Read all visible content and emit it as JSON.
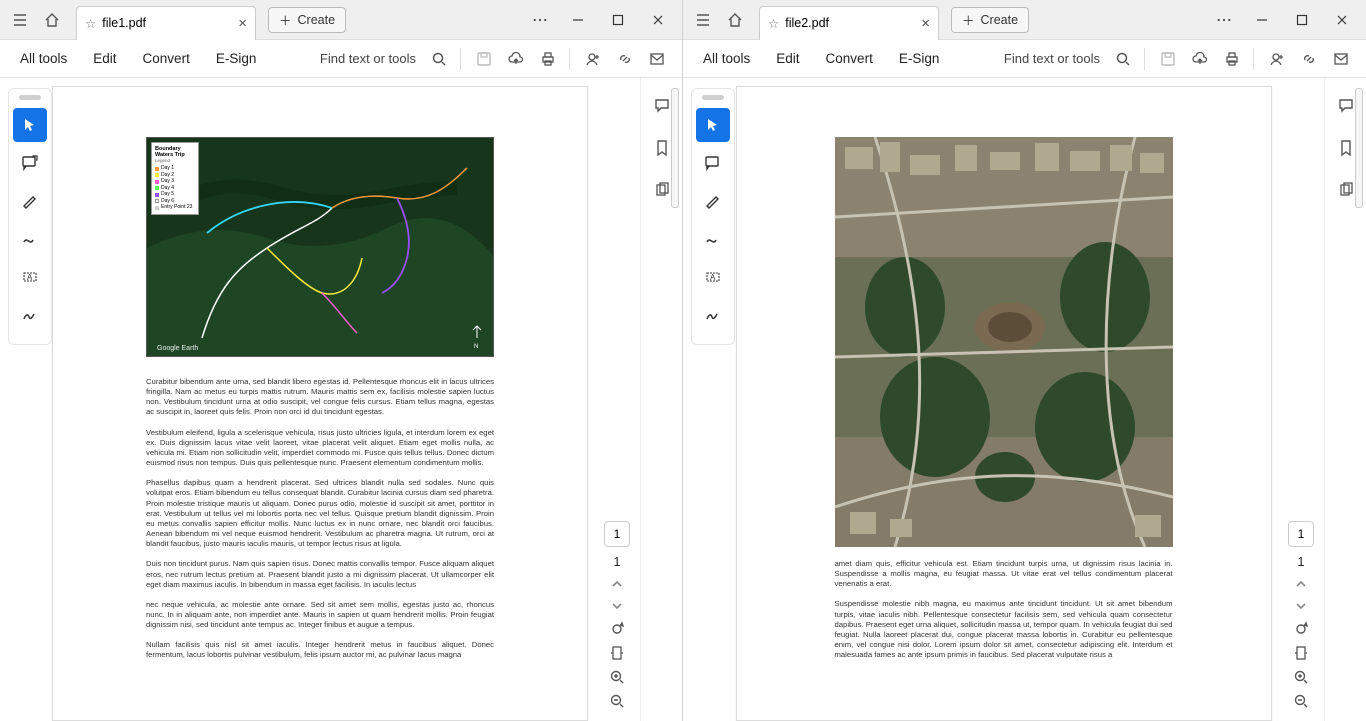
{
  "panes": [
    {
      "tab_title": "file1.pdf",
      "create_label": "Create",
      "menus": {
        "all_tools": "All tools",
        "edit": "Edit",
        "convert": "Convert",
        "esign": "E-Sign"
      },
      "find_label": "Find text or tools",
      "page_current": "1",
      "page_total": "1",
      "map": {
        "title": "Boundary Waters Trip",
        "legend_label": "Legend",
        "items": [
          {
            "label": "Day 1",
            "color": "#ff9a3c"
          },
          {
            "label": "Day 2",
            "color": "#ffeb3b"
          },
          {
            "label": "Day 3",
            "color": "#ff5dd2"
          },
          {
            "label": "Day 4",
            "color": "#55ff55"
          },
          {
            "label": "Day 5",
            "color": "#9a4dff"
          },
          {
            "label": "Day 6",
            "color": "#ffffff"
          },
          {
            "label": "Entry Point 23",
            "color": "#d0d0d0"
          }
        ],
        "watermark": "Google Earth"
      },
      "paragraphs": [
        "Curabitur bibendum ante urna, sed blandit libero egestas id. Pellentesque rhoncus elit in lacus ultrices fringilla. Nam ac metus eu turpis mattis rutrum. Mauris mattis sem ex, facilisis molestie sapien luctus non. Vestibulum tincidunt urna at odio suscipit, vel congue felis cursus. Etiam tellus magna, egestas ac suscipit in, laoreet quis felis. Proin non orci id dui tincidunt egestas.",
        "Vestibulum eleifend, ligula a scelerisque vehicula, risus justo ultricies ligula, et interdum lorem ex eget ex. Duis dignissim lacus vitae velit laoreet, vitae placerat velit aliquet. Etiam eget mollis nulla, ac vehicula mi. Etiam non sollicitudin velit, imperdiet commodo mi. Fusce quis tellus tellus. Donec dictum euismod risus non tempus. Duis quis pellentesque nunc. Praesent elementum condimentum mollis.",
        "Phasellus dapibus quam a hendrerit placerat. Sed ultrices blandit nulla sed sodales. Nunc quis volutpat eros. Etiam bibendum eu tellus consequat blandit. Curabitur lacinia cursus diam sed pharetra. Proin molestie tristique mauris ut aliquam. Donec purus odio, molestie id suscipit sit amet, porttitor in erat. Vestibulum ut tellus vel mi lobortis porta nec vel tellus. Quisque pretium blandit dignissim. Proin eu metus convallis sapien efficitur mollis. Nunc luctus ex in nunc ornare, nec blandit orci faucibus. Aenean bibendum mi vel neque euismod hendrerit. Vestibulum ac pharetra magna. Ut rutrum, orci at blandit faucibus, justo mauris iaculis mauris, ut tempor lectus risus at ligula.",
        "Duis non tincidunt purus. Nam quis sapien risus. Donec mattis convallis tempor. Fusce aliquam aliquet eros, nec rutrum lectus pretium at. Praesent blandit justo a mi dignissim placerat. Ut ullamcorper elit eget diam maximus iaculis. In bibendum in massa eget facilisis. In iaculis lectus",
        "nec neque vehicula, ac molestie ante ornare. Sed sit amet sem mollis, egestas justo ac, rhoncus nunc. In in aliquam ante, non imperdiet ante. Mauris in sapien ut quam hendrerit mollis. Proin feugiat dignissim nisi, sed tincidunt ante tempus ac. Integer finibus et augue a tempus.",
        "Nullam facilisis quis nisl sit amet iaculis. Integer hendrerit metus in faucibus aliquet. Donec fermentum, lacus lobortis pulvinar vestibulum, felis ipsum auctor mi, ac pulvinar lacus magna"
      ]
    },
    {
      "tab_title": "file2.pdf",
      "create_label": "Create",
      "menus": {
        "all_tools": "All tools",
        "edit": "Edit",
        "convert": "Convert",
        "esign": "E-Sign"
      },
      "find_label": "Find text or tools",
      "page_current": "1",
      "page_total": "1",
      "paragraphs": [
        "amet diam quis, efficitur vehicula est. Etiam tincidunt turpis urna, ut dignissim risus lacinia in. Suspendisse a mollis magna, eu feugiat massa. Ut vitae erat vel tellus condimentum placerat venenatis a erat.",
        "Suspendisse molestie nibh magna, eu maximus ante tincidunt tincidunt. Ut sit amet bibendum turpis, vitae iaculis nibh. Pellentesque consectetur facilisis sem, sed vehicula quam consectetur dapibus. Praesent eget urna aliquet, sollicitudin massa ut, tempor quam. In vehicula feugiat dui sed feugiat. Nulla laoreet placerat dui, congue placerat massa lobortis in. Curabitur eu pellentesque enim, vel congue nisi dolor. Lorem ipsum dolor sit amet, consectetur adipiscing elit. Interdum et malesuada fames ac ante ipsum primis in faucibus. Sed placerat vulputate risus a"
      ]
    }
  ]
}
